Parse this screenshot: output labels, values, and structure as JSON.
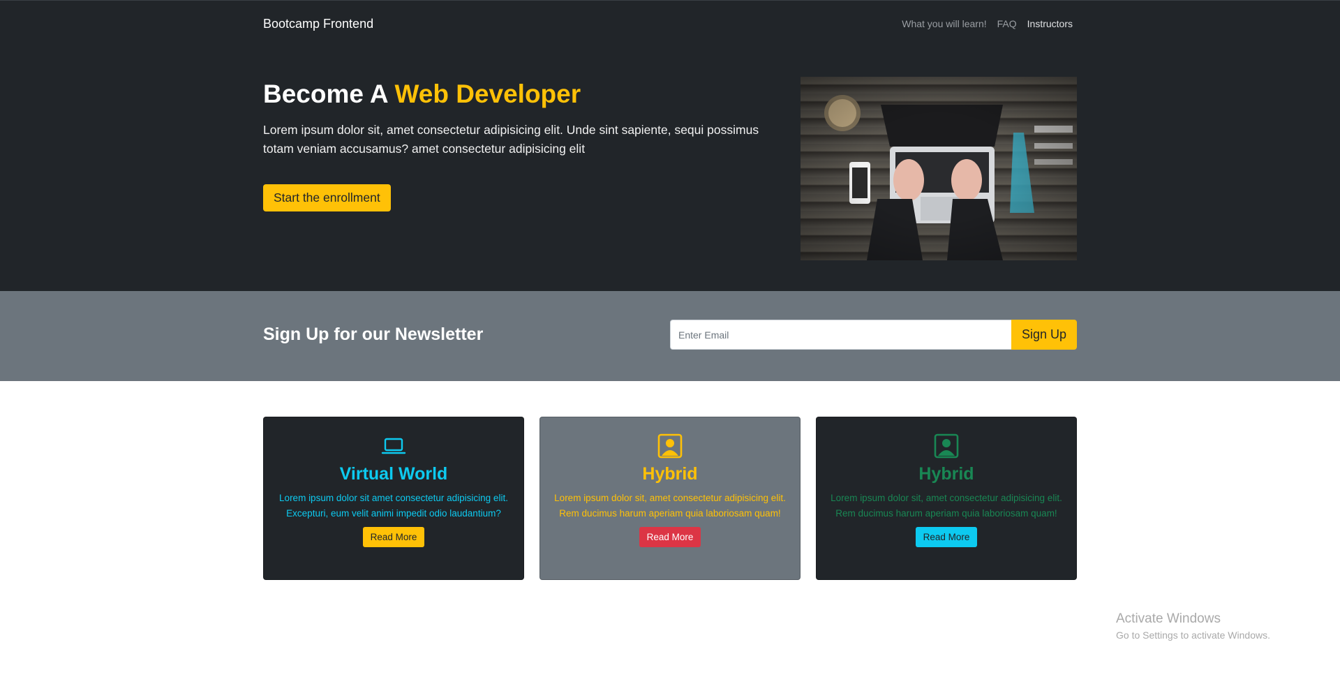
{
  "nav": {
    "brand": "Bootcamp Frontend",
    "links": [
      "What you will learn!",
      "FAQ",
      "Instructors"
    ]
  },
  "hero": {
    "title_prefix": "Become A",
    "title_accent": "Web Developer",
    "description": "Lorem ipsum dolor sit, amet consectetur adipisicing elit. Unde sint sapiente, sequi possimus totam veniam accusamus? amet consectetur adipisicing elit",
    "cta_label": "Start the enrollment",
    "image_icon": "laptop-desk-photo"
  },
  "newsletter": {
    "title": "Sign Up for our Newsletter",
    "input_placeholder": "Enter Email",
    "button_label": "Sign Up"
  },
  "cards": [
    {
      "icon": "laptop-icon",
      "title": "Virtual World",
      "text": "Lorem ipsum dolor sit amet consectetur adipisicing elit. Excepturi, eum velit animi impedit odio laudantium?",
      "button_label": "Read More"
    },
    {
      "icon": "person-square-icon",
      "title": "Hybrid",
      "text": "Lorem ipsum dolor sit, amet consectetur adipisicing elit. Rem ducimus harum aperiam quia laboriosam quam!",
      "button_label": "Read More"
    },
    {
      "icon": "person-square-icon",
      "title": "Hybrid",
      "text": "Lorem ipsum dolor sit, amet consectetur adipisicing elit. Rem ducimus harum aperiam quia laboriosam quam!",
      "button_label": "Read More"
    }
  ],
  "colors": {
    "dark": "#212529",
    "grey": "#6c757d",
    "warning": "#ffc107",
    "info": "#0dcaf0",
    "success": "#198754",
    "danger": "#dc3545"
  },
  "watermark": {
    "title": "Activate Windows",
    "subtitle": "Go to Settings to activate Windows."
  }
}
